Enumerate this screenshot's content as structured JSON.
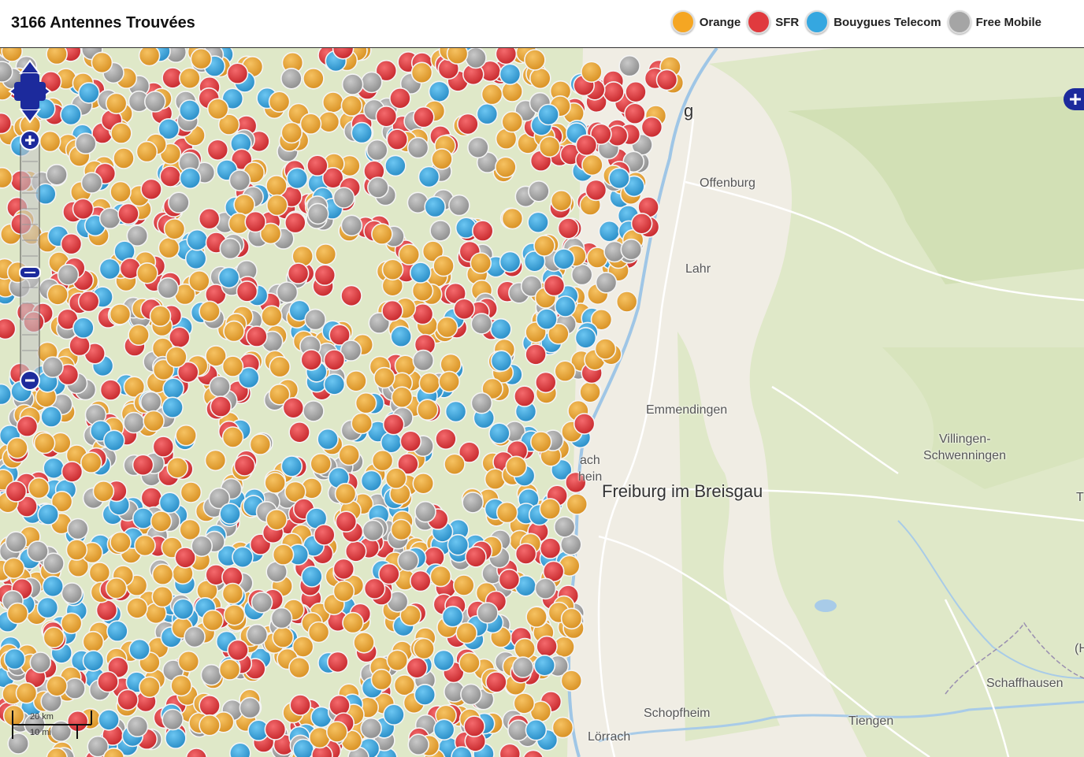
{
  "header": {
    "title": "3166 Antennes Trouvées"
  },
  "legend": [
    {
      "label": "Orange",
      "color": "#f5a623"
    },
    {
      "label": "SFR",
      "color": "#e03a3e"
    },
    {
      "label": "Bouygues Telecom",
      "color": "#35a7e0"
    },
    {
      "label": "Free Mobile",
      "color": "#a5a5a5"
    }
  ],
  "map": {
    "places": [
      {
        "label": "Offenburg"
      },
      {
        "label": "Lahr"
      },
      {
        "label": "Emmendingen"
      },
      {
        "label": "Villingen-"
      },
      {
        "label": "Schwenningen"
      },
      {
        "label": "Freiburg im Breisgau"
      },
      {
        "label": "Schaffhausen"
      },
      {
        "label": "Schopfheim"
      },
      {
        "label": "Tiengen"
      },
      {
        "label": "Lörrach"
      },
      {
        "label": "g"
      },
      {
        "label": "ach"
      },
      {
        "label": "hein"
      },
      {
        "label": "(H"
      },
      {
        "label": "T"
      }
    ],
    "scale": {
      "top_label": "20 km",
      "bottom_label": "10 mi"
    },
    "icons": [
      "pan-arrows-icon",
      "zoom-in-icon",
      "zoom-out-icon",
      "layer-switcher-icon"
    ]
  }
}
